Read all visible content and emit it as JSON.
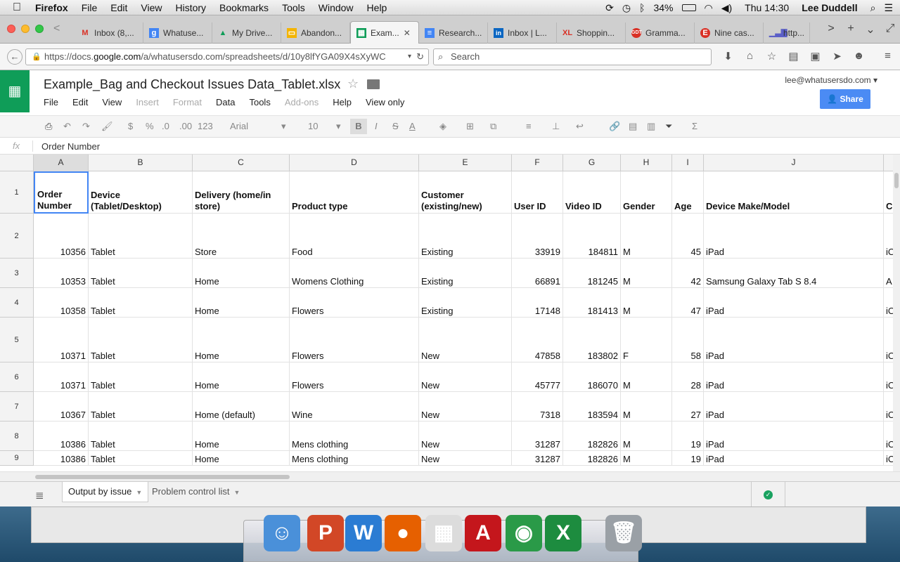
{
  "menubar": {
    "app": "Firefox",
    "items": [
      "File",
      "Edit",
      "View",
      "History",
      "Bookmarks",
      "Tools",
      "Window",
      "Help"
    ],
    "battery": "34%",
    "clock": "Thu 14:30",
    "user": "Lee Duddell"
  },
  "tabs": [
    {
      "label": "Inbox (8,...",
      "icon": "gmail-icon",
      "color": "#d93025"
    },
    {
      "label": "Whatuse...",
      "icon": "google-icon",
      "color": "#4285f4"
    },
    {
      "label": "My Drive...",
      "icon": "drive-icon",
      "color": "#0f9d58"
    },
    {
      "label": "Abandon...",
      "icon": "slides-icon",
      "color": "#f4b400"
    },
    {
      "label": "Exam...",
      "icon": "sheets-icon",
      "color": "#0f9d58",
      "active": true
    },
    {
      "label": "Research...",
      "icon": "docs-icon",
      "color": "#4285f4"
    },
    {
      "label": "Inbox | L...",
      "icon": "linkedin-icon",
      "color": "#0a66c2"
    },
    {
      "label": "Shoppin...",
      "icon": "xl-icon",
      "color": "#d93025"
    },
    {
      "label": "Gramma...",
      "icon": "grammar-icon",
      "color": "#d93025"
    },
    {
      "label": "Nine cas...",
      "icon": "e-icon",
      "color": "#d93025"
    },
    {
      "label": "http...",
      "icon": "chart-icon",
      "color": "#5b5fc7"
    }
  ],
  "nav": {
    "url_prefix": "https://docs.",
    "url_domain": "google.com",
    "url_rest": "/a/whatusersdo.com/spreadsheets/d/10y8lfYGA09X4sXyWC",
    "search_placeholder": "Search"
  },
  "doc": {
    "title": "Example_Bag and Checkout Issues Data_Tablet.xlsx",
    "menu": [
      {
        "label": "File",
        "disabled": false
      },
      {
        "label": "Edit",
        "disabled": false
      },
      {
        "label": "View",
        "disabled": false
      },
      {
        "label": "Insert",
        "disabled": true
      },
      {
        "label": "Format",
        "disabled": true
      },
      {
        "label": "Data",
        "disabled": false
      },
      {
        "label": "Tools",
        "disabled": false
      },
      {
        "label": "Add-ons",
        "disabled": true
      },
      {
        "label": "Help",
        "disabled": false
      },
      {
        "label": "View only",
        "disabled": false
      }
    ],
    "email": "lee@whatusersdo.com",
    "share": "Share"
  },
  "toolbar": {
    "currency": "$",
    "percent": "%",
    "dec_less": ".0",
    "dec_more": ".00",
    "format": "123",
    "font": "Arial",
    "size": "10",
    "bold": "B",
    "italic": "I",
    "strike": "S",
    "textcolor": "A"
  },
  "formula": {
    "fx": "fx",
    "value": "Order Number"
  },
  "grid": {
    "columns": [
      "A",
      "B",
      "C",
      "D",
      "E",
      "F",
      "G",
      "H",
      "I",
      "J"
    ],
    "headers": [
      "Order Number",
      "Device (Tablet/Desktop)",
      "Delivery (home/in store)",
      "Product type",
      "Customer (existing/new)",
      "User ID",
      "Video ID",
      "Gender",
      "Age",
      "Device Make/Model",
      "C"
    ],
    "rows": [
      {
        "n": "1"
      },
      {
        "n": "2",
        "cells": [
          "10356",
          "Tablet",
          "Store",
          "Food",
          "Existing",
          "33919",
          "184811",
          "M",
          "45",
          "iPad",
          "iO"
        ]
      },
      {
        "n": "3",
        "cells": [
          "10353",
          "Tablet",
          "Home",
          "Womens Clothing",
          "Existing",
          "66891",
          "181245",
          "M",
          "42",
          "Samsung Galaxy Tab S 8.4",
          "A"
        ]
      },
      {
        "n": "4",
        "cells": [
          "10358",
          "Tablet",
          "Home",
          "Flowers",
          "Existing",
          "17148",
          "181413",
          "M",
          "47",
          "iPad",
          "iO"
        ]
      },
      {
        "n": "5",
        "cells": [
          "10371",
          "Tablet",
          "Home",
          "Flowers",
          "New",
          "47858",
          "183802",
          "F",
          "58",
          "iPad",
          "iO"
        ]
      },
      {
        "n": "6",
        "cells": [
          "10371",
          "Tablet",
          "Home",
          "Flowers",
          "New",
          "45777",
          "186070",
          "M",
          "28",
          "iPad",
          "iO"
        ]
      },
      {
        "n": "7",
        "cells": [
          "10367",
          "Tablet",
          "Home (default)",
          "Wine",
          "New",
          "7318",
          "183594",
          "M",
          "27",
          "iPad",
          "iO"
        ]
      },
      {
        "n": "8",
        "cells": [
          "10386",
          "Tablet",
          "Home",
          "Mens clothing",
          "New",
          "31287",
          "182826",
          "M",
          "19",
          "iPad",
          "iO"
        ]
      },
      {
        "n": "9",
        "cells": [
          "10386",
          "Tablet",
          "Home",
          "Mens clothing",
          "New",
          "31287",
          "182826",
          "M",
          "19",
          "iPad",
          "iO"
        ]
      }
    ]
  },
  "sheets": [
    {
      "label": "Output by issue",
      "active": true
    },
    {
      "label": "Problem control list",
      "active": false
    }
  ],
  "dock": [
    {
      "name": "finder-icon",
      "glyph": "☺",
      "color": "#4a90d9"
    },
    {
      "name": "powerpoint-icon",
      "glyph": "P",
      "color": "#d24726"
    },
    {
      "name": "word-icon",
      "glyph": "W",
      "color": "#2b7cd3"
    },
    {
      "name": "firefox-icon",
      "glyph": "●",
      "color": "#e66000"
    },
    {
      "name": "launchpad-icon",
      "glyph": "▦",
      "color": "#dcdcdc"
    },
    {
      "name": "acrobat-icon",
      "glyph": "A",
      "color": "#c4161c"
    },
    {
      "name": "chrome-icon",
      "glyph": "◉",
      "color": "#2a9a48"
    },
    {
      "name": "excel-icon",
      "glyph": "X",
      "color": "#1d8c3f"
    },
    {
      "name": "trash-icon",
      "glyph": "🗑",
      "color": "#9aa0a6"
    }
  ]
}
